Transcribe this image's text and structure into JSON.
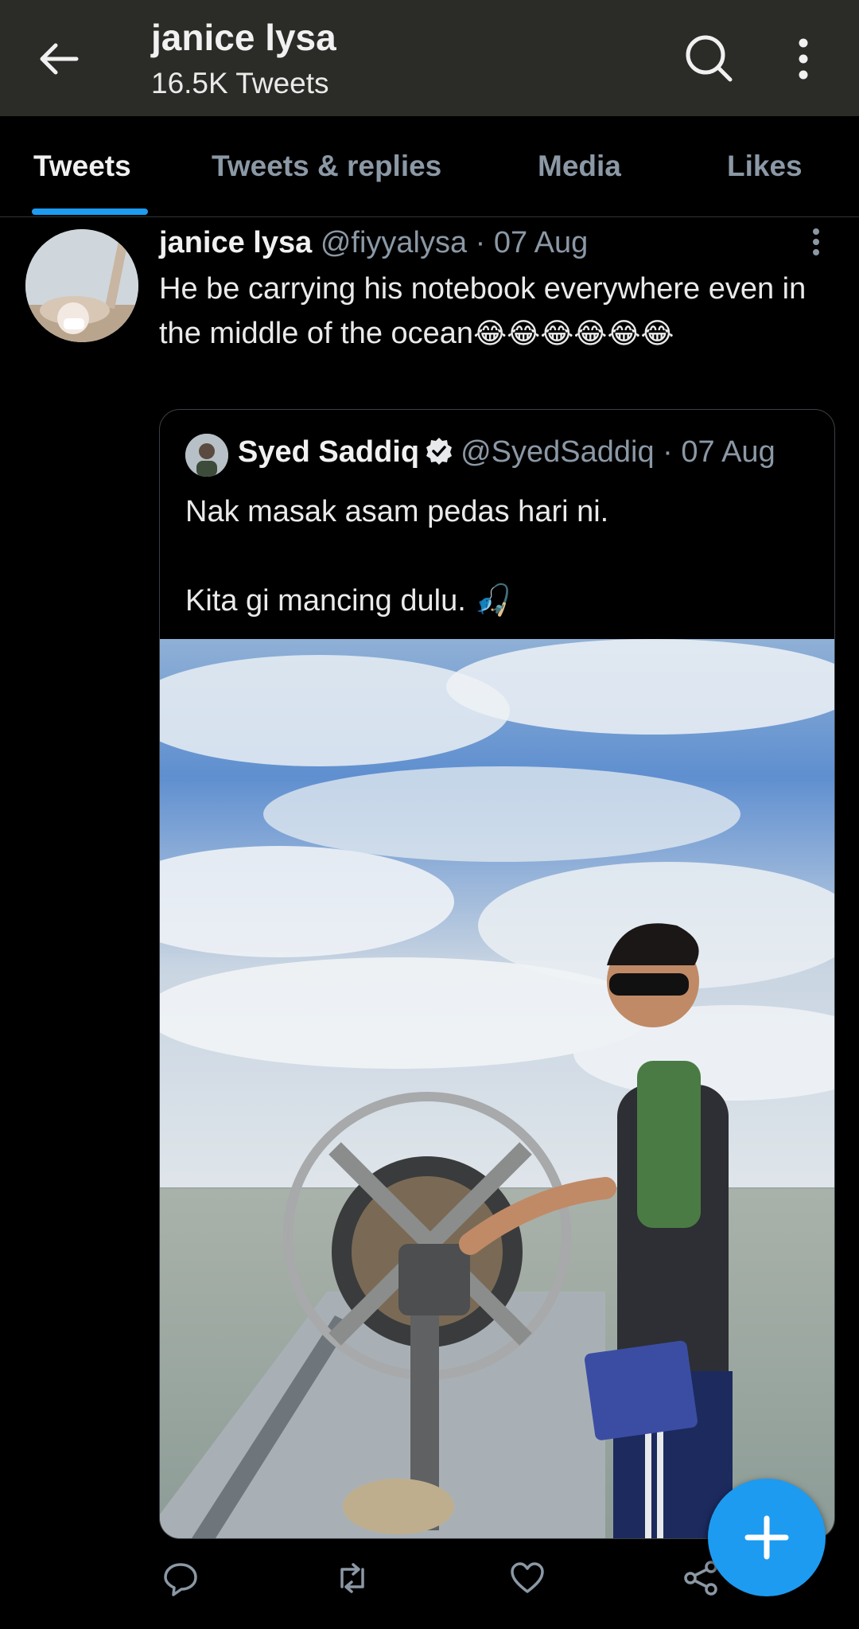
{
  "header": {
    "title": "janice lysa",
    "subtitle": "16.5K Tweets",
    "back_icon": "arrow-left-icon",
    "search_icon": "search-icon",
    "more_icon": "more-vertical-icon"
  },
  "tabs": [
    {
      "label": "Tweets",
      "active": true
    },
    {
      "label": "Tweets & replies",
      "active": false
    },
    {
      "label": "Media",
      "active": false
    },
    {
      "label": "Likes",
      "active": false
    }
  ],
  "tweet": {
    "name": "janice lysa",
    "handle": "@fiyyalysa",
    "separator": "·",
    "date": "07 Aug",
    "text": "He be carrying his notebook everywhere even in the middle of the ocean",
    "emojis": "😂😂😂😂😂😂"
  },
  "quote": {
    "name": "Syed Saddiq",
    "handle": "@SyedSaddiq",
    "separator": "·",
    "date": "07 Aug",
    "text": "Nak masak asam pedas hari ni.\n\nKita gi mancing dulu. 🎣"
  },
  "actions": {
    "reply_icon": "reply-icon",
    "retweet_icon": "retweet-icon",
    "like_icon": "heart-icon",
    "share_icon": "share-icon"
  },
  "fab": {
    "icon": "plus-icon"
  },
  "colors": {
    "accent": "#1d9bf0",
    "topbar": "#2b2b27",
    "muted": "#8b98a5"
  }
}
